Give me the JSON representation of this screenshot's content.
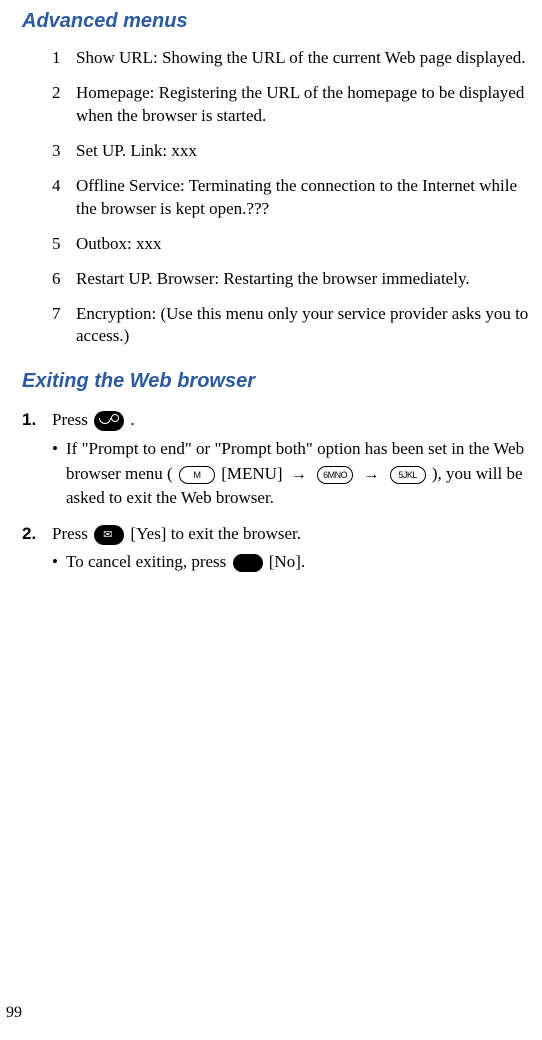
{
  "headings": {
    "advanced": "Advanced menus",
    "exiting": "Exiting the Web browser"
  },
  "menu": {
    "n1": "1",
    "t1": "Show URL: Showing the URL of the current Web page displayed.",
    "n2": "2",
    "t2": "Homepage: Registering the URL of the homepage to be displayed when the browser is started.",
    "n3": "3",
    "t3": "Set UP. Link: xxx",
    "n4": "4",
    "t4": "Offline Service: Terminating the connection to the Internet while the browser is kept open.???",
    "n5": "5",
    "t5": "Outbox: xxx",
    "n6": "6",
    "t6": "Restart UP. Browser: Restarting the browser immediately.",
    "n7": "7",
    "t7": "Encryption: (Use this menu only your service provider asks you to access.)"
  },
  "steps": {
    "s1n": "1.",
    "s1_press": "Press ",
    "s1_dot": ".",
    "s1b_dot": "•",
    "s1b_a": "If \"Prompt to end\" or \"Prompt both\" option has been set in the Web browser menu ( ",
    "s1b_menu": " [MENU] ",
    "s1b_b": " ), you will be asked to exit the Web browser.",
    "s2n": "2.",
    "s2_press": "Press ",
    "s2_yes": " [Yes] to exit the browser.",
    "s2b_dot": "•",
    "s2b_a": "To cancel exiting, press ",
    "s2b_no": " [No]."
  },
  "keys": {
    "M": "M",
    "six": "6MNO",
    "five": "5JKL"
  },
  "pageNumber": "99"
}
